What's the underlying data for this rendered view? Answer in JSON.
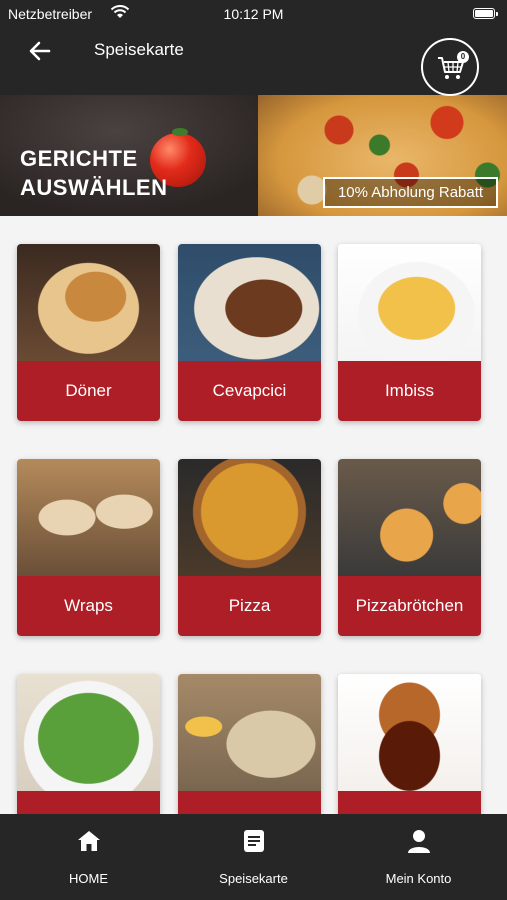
{
  "status_bar": {
    "carrier": "Netzbetreiber",
    "time": "10:12 PM"
  },
  "header": {
    "title": "Speisekarte",
    "cart_count": "0"
  },
  "banner": {
    "headline_line1": "GERICHTE",
    "headline_line2": "AUSWÄHLEN",
    "promo": "10% Abholung Rabatt"
  },
  "categories": [
    {
      "label": "Döner"
    },
    {
      "label": "Cevapcici"
    },
    {
      "label": "Imbiss"
    },
    {
      "label": "Wraps"
    },
    {
      "label": "Pizza"
    },
    {
      "label": "Pizzabrötchen"
    },
    {
      "label": ""
    },
    {
      "label": ""
    },
    {
      "label": ""
    }
  ],
  "tabs": [
    {
      "label": "HOME",
      "icon": "home-icon"
    },
    {
      "label": "Speisekarte",
      "icon": "menu-icon"
    },
    {
      "label": "Mein Konto",
      "icon": "user-icon"
    }
  ],
  "colors": {
    "bar": "#262626",
    "accent": "#ad1e27",
    "background": "#f4f4f4"
  }
}
